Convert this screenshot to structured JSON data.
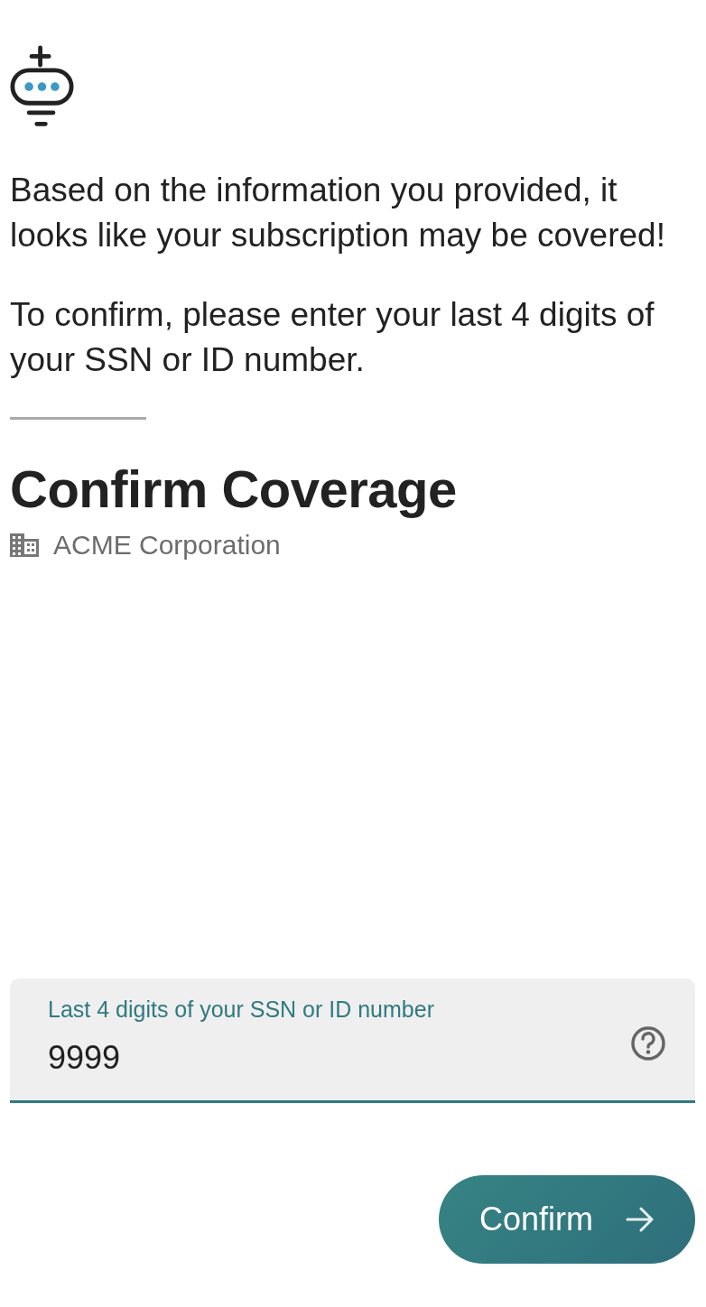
{
  "messages": [
    "Based on the information you provided, it looks like your subscription may be covered!",
    "To confirm, please enter your last 4 digits of your SSN or ID number."
  ],
  "title": "Confirm Coverage",
  "organization": "ACME Corporation",
  "field": {
    "label": "Last 4 digits of your SSN or ID number",
    "value": "9999"
  },
  "button": {
    "label": "Confirm"
  }
}
